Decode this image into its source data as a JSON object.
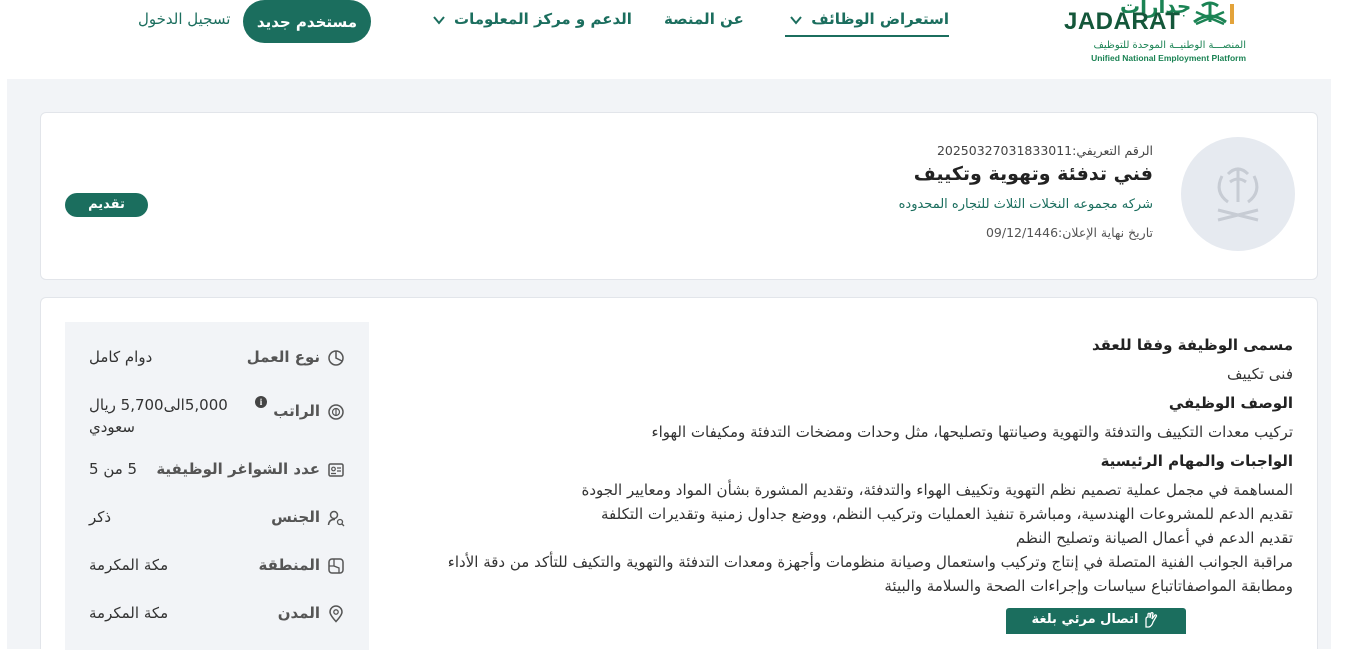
{
  "header": {
    "logo": {
      "arabic": "جدارات",
      "english": "JADARAT",
      "subtitle_ar": "المنصـــة الوطنيــة الموحدة للتوظيف",
      "subtitle_en": "Unified National Employment Platform"
    },
    "nav": {
      "jobs": "استعراض الوظائف",
      "about": "عن المنصة",
      "support": "الدعم و مركز المعلومات"
    },
    "register_label": "مستخدم جديد",
    "login_label": "تسجيل الدخول"
  },
  "job": {
    "reference": "الرقم التعريفي:20250327031833011",
    "title": "فني تدفئة وتهوية وتكييف",
    "company": "شركه مجموعه النخلات الثلاث للتجاره المحدوده",
    "deadline": "تاريخ نهاية الإعلان:09/12/1446",
    "apply_label": "تقديم"
  },
  "details": {
    "contract_title_heading": "مسمى الوظيفة وفقا للعقد",
    "contract_title": "فنى تكييف",
    "description_heading": "الوصف الوظيفي",
    "description": "تركيب معدات التكييف والتدفئة والتهوية وصيانتها وتصليحها، مثل وحدات ومضخات التدفئة ومكيفات الهواء",
    "duties_heading": "الواجبات والمهام الرئيسية",
    "duties": [
      "المساهمة في مجمل عملية تصميم نظم التهوية وتكييف الهواء والتدفئة، وتقديم المشورة بشأن المواد ومعايير الجودة",
      "تقديم الدعم للمشروعات الهندسية، ومباشرة تنفيذ العمليات وتركيب النظم، ووضع جداول زمنية وتقديرات التكلفة",
      "تقديم الدعم في أعمال الصيانة وتصليح النظم",
      "مراقبة الجوانب الفنية المتصلة في إنتاج وتركيب واستعمال وصيانة منظومات وأجهزة ومعدات التدفئة والتهوية  والتكيف  للتأكد من دقة الأداء",
      "ومطابقة المواصفاتاتباع سياسات وإجراءات الصحة والسلامة والبيئة"
    ]
  },
  "sidebar": {
    "work_type": {
      "label": "نوع العمل",
      "value": "دوام كامل"
    },
    "salary": {
      "label": "الراتب",
      "value_line1": "5,000الى5,700 ريال",
      "value_line2": "سعودي"
    },
    "vacancies": {
      "label": "عدد الشواغر الوظيفية",
      "value": "5  من 5"
    },
    "gender": {
      "label": "الجنس",
      "value": "ذكر"
    },
    "region": {
      "label": "المنطقة",
      "value": "مكة المكرمة"
    },
    "city": {
      "label": "المدن",
      "value": "مكة المكرمة"
    }
  },
  "sign_language_label": "اتصال مرئي بلغة الإشارة",
  "colors": {
    "primary": "#1b6e5e",
    "brand_green": "#1b8354",
    "background": "#f2f4f7"
  }
}
